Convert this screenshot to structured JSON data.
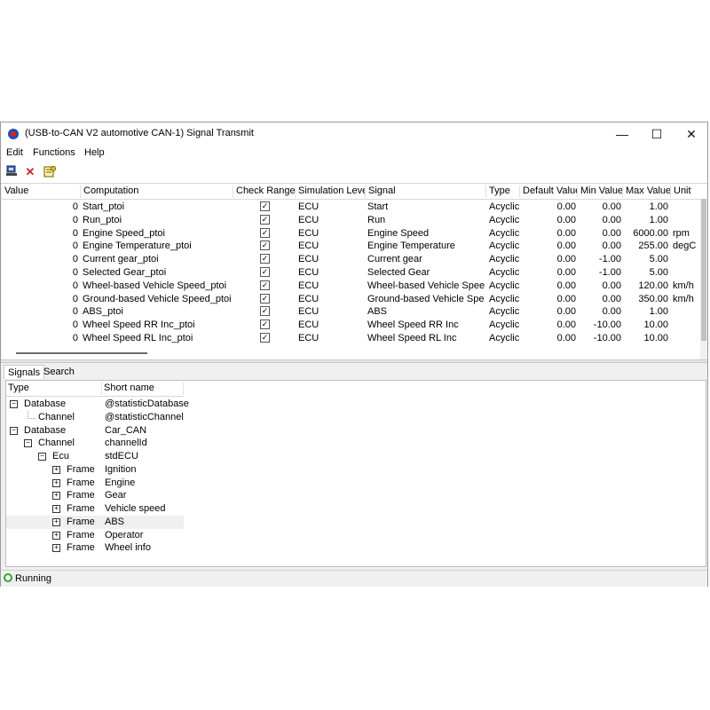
{
  "window": {
    "title": "(USB-to-CAN V2 automotive  CAN-1) Signal Transmit",
    "minimize": "—",
    "maximize": "☐",
    "close": "✕"
  },
  "menu": [
    "Edit",
    "Functions",
    "Help"
  ],
  "toolbar": {
    "add_icon": "add-signal-icon",
    "delete_icon": "delete-icon",
    "properties_icon": "properties-icon"
  },
  "grid": {
    "headers": [
      "Value",
      "Computation",
      "Check Ranges",
      "Simulation Level",
      "Signal",
      "Type",
      "Default Value",
      "Min Value",
      "Max Value",
      "Unit"
    ],
    "rows": [
      {
        "value": "0",
        "computation": "Start_ptoi",
        "check": true,
        "level": "ECU",
        "signal": "Start",
        "type": "Acyclic",
        "default": "0.00",
        "min": "0.00",
        "max": "1.00",
        "unit": ""
      },
      {
        "value": "0",
        "computation": "Run_ptoi",
        "check": true,
        "level": "ECU",
        "signal": "Run",
        "type": "Acyclic",
        "default": "0.00",
        "min": "0.00",
        "max": "1.00",
        "unit": ""
      },
      {
        "value": "0",
        "computation": "Engine Speed_ptoi",
        "check": true,
        "level": "ECU",
        "signal": "Engine Speed",
        "type": "Acyclic",
        "default": "0.00",
        "min": "0.00",
        "max": "6000.00",
        "unit": "rpm"
      },
      {
        "value": "0",
        "computation": "Engine Temperature_ptoi",
        "check": true,
        "level": "ECU",
        "signal": "Engine Temperature",
        "type": "Acyclic",
        "default": "0.00",
        "min": "0.00",
        "max": "255.00",
        "unit": "degC"
      },
      {
        "value": "0",
        "computation": "Current gear_ptoi",
        "check": true,
        "level": "ECU",
        "signal": "Current gear",
        "type": "Acyclic",
        "default": "0.00",
        "min": "-1.00",
        "max": "5.00",
        "unit": ""
      },
      {
        "value": "0",
        "computation": "Selected Gear_ptoi",
        "check": true,
        "level": "ECU",
        "signal": "Selected Gear",
        "type": "Acyclic",
        "default": "0.00",
        "min": "-1.00",
        "max": "5.00",
        "unit": ""
      },
      {
        "value": "0",
        "computation": "Wheel-based Vehicle Speed_ptoi",
        "check": true,
        "level": "ECU",
        "signal": "Wheel-based Vehicle Speed",
        "type": "Acyclic",
        "default": "0.00",
        "min": "0.00",
        "max": "120.00",
        "unit": "km/h"
      },
      {
        "value": "0",
        "computation": "Ground-based Vehicle Speed_ptoi",
        "check": true,
        "level": "ECU",
        "signal": "Ground-based Vehicle Speed",
        "type": "Acyclic",
        "default": "0.00",
        "min": "0.00",
        "max": "350.00",
        "unit": "km/h"
      },
      {
        "value": "0",
        "computation": "ABS_ptoi",
        "check": true,
        "level": "ECU",
        "signal": "ABS",
        "type": "Acyclic",
        "default": "0.00",
        "min": "0.00",
        "max": "1.00",
        "unit": ""
      },
      {
        "value": "0",
        "computation": "Wheel Speed RR Inc_ptoi",
        "check": true,
        "level": "ECU",
        "signal": "Wheel Speed RR Inc",
        "type": "Acyclic",
        "default": "0.00",
        "min": "-10.00",
        "max": "10.00",
        "unit": ""
      },
      {
        "value": "0",
        "computation": "Wheel Speed RL Inc_ptoi",
        "check": true,
        "level": "ECU",
        "signal": "Wheel Speed RL Inc",
        "type": "Acyclic",
        "default": "0.00",
        "min": "-10.00",
        "max": "10.00",
        "unit": ""
      }
    ]
  },
  "tabs": [
    "Signals",
    "Search"
  ],
  "tree": {
    "headers": [
      "Type",
      "Short name"
    ],
    "rows": [
      {
        "expander": "⊟",
        "type": "Database",
        "name": "@statisticDatabase"
      },
      {
        "expander": "",
        "type": "Channel",
        "name": "@statisticChannel"
      },
      {
        "expander": "⊟",
        "type": "Database",
        "name": "Car_CAN"
      },
      {
        "expander": "⊟",
        "type": "Channel",
        "name": "channelId"
      },
      {
        "expander": "⊟",
        "type": "Ecu",
        "name": "stdECU"
      },
      {
        "expander": "⊞",
        "type": "Frame",
        "name": "Ignition"
      },
      {
        "expander": "⊞",
        "type": "Frame",
        "name": "Engine"
      },
      {
        "expander": "⊞",
        "type": "Frame",
        "name": "Gear"
      },
      {
        "expander": "⊞",
        "type": "Frame",
        "name": "Vehicle speed"
      },
      {
        "expander": "⊞",
        "type": "Frame",
        "name": "ABS"
      },
      {
        "expander": "⊞",
        "type": "Frame",
        "name": "Operator"
      },
      {
        "expander": "⊞",
        "type": "Frame",
        "name": "Wheel info"
      }
    ]
  },
  "status": {
    "text": "Running",
    "icon": "running-status-icon"
  }
}
